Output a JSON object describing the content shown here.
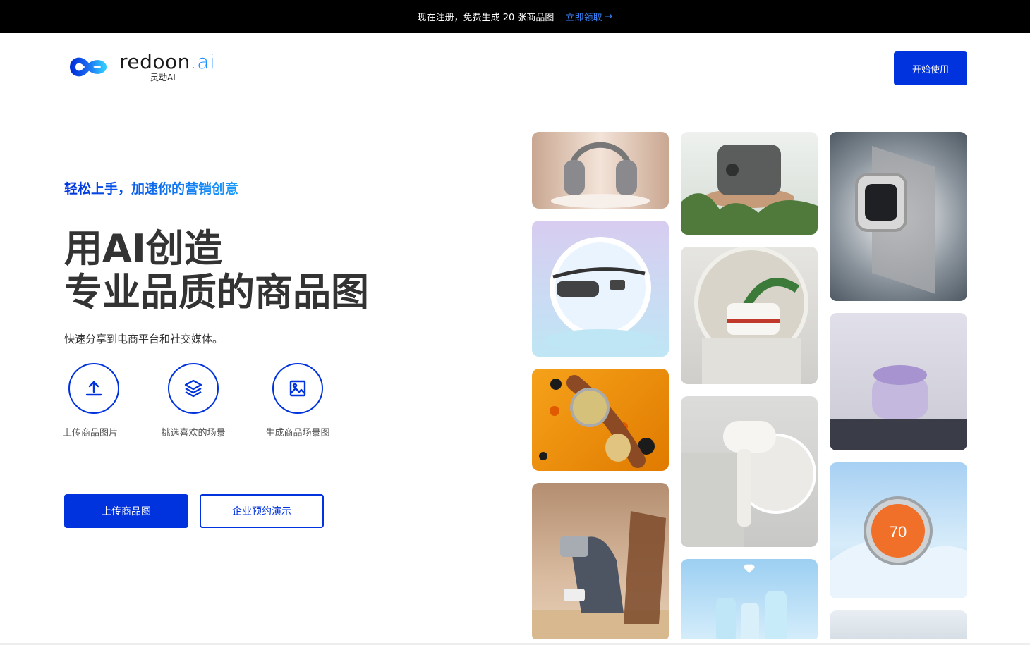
{
  "promo_bar": {
    "message": "现在注册，免费生成 20 张商品图",
    "link_label": "立即领取",
    "link_icon": "arrow-right-icon"
  },
  "logo": {
    "brand": "redoon",
    "brand_suffix": ".ai",
    "sub": "灵动AI"
  },
  "header": {
    "cta_label": "开始使用"
  },
  "hero": {
    "tagline": "轻松上手，加速你的营销创意",
    "headline_line1": "用AI创造",
    "headline_line2": "专业品质的商品图",
    "description": "快速分享到电商平台和社交媒体。"
  },
  "steps": [
    {
      "label": "上传商品图片",
      "icon": "upload-icon"
    },
    {
      "label": "挑选喜欢的场景",
      "icon": "layers-icon"
    },
    {
      "label": "生成商品场景图",
      "icon": "image-icon"
    }
  ],
  "actions": {
    "primary_label": "上传商品图",
    "secondary_label": "企业预约演示"
  },
  "colors": {
    "accent": "#0033dd",
    "promo_bg": "#000000",
    "link": "#3b82f6"
  },
  "gallery": [
    {
      "name": "headphones-image"
    },
    {
      "name": "smart-glasses-image"
    },
    {
      "name": "leather-watch-image"
    },
    {
      "name": "coffee-machine-image"
    },
    {
      "name": "rice-cooker-image"
    },
    {
      "name": "white-pot-image"
    },
    {
      "name": "hair-dryer-image"
    },
    {
      "name": "tumbler-set-image"
    },
    {
      "name": "smartwatch-image"
    },
    {
      "name": "earbuds-image"
    },
    {
      "name": "thermostat-image"
    },
    {
      "name": "partial-product-image"
    }
  ]
}
